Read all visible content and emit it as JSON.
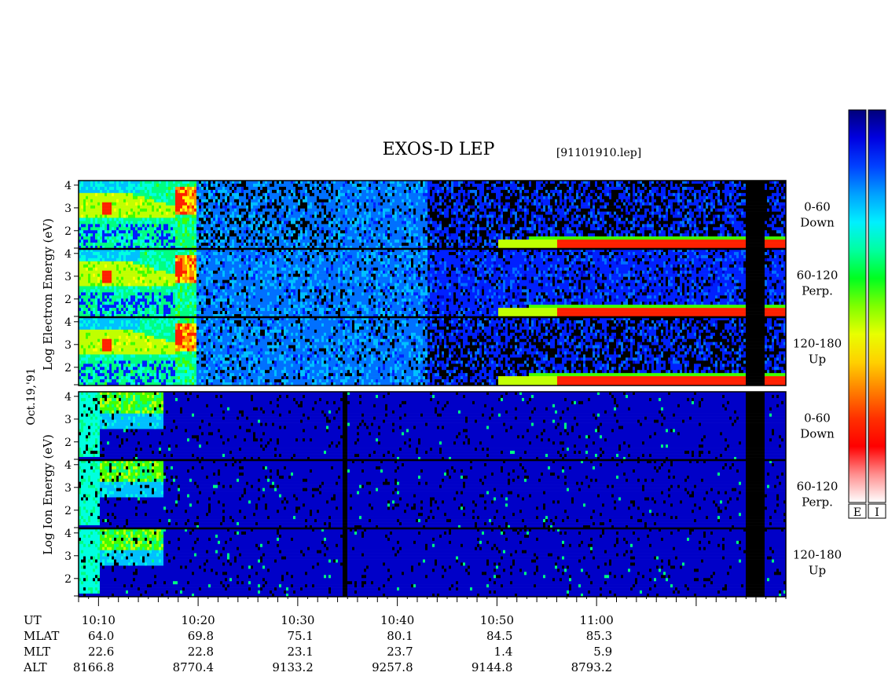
{
  "title": "EXOS-D LEP",
  "file_label": "[91101910.lep]",
  "date_label": "Oct.19,'91",
  "electron_ylabel": "Log  Electron  Energy  (eV)",
  "ion_ylabel": "Log  Ion  Energy  (eV)",
  "row_labels": [
    "UT",
    "MLAT",
    "MLT",
    "ALT"
  ],
  "colorbar": {
    "labels": [
      "E",
      "I"
    ],
    "colors": [
      "#00007a",
      "#0000ff",
      "#0080ff",
      "#00ffff",
      "#00ff80",
      "#00ff00",
      "#80ff00",
      "#ffff00",
      "#ff8000",
      "#ff0000",
      "#ffc0c0",
      "#ffffff"
    ]
  },
  "chart_data": {
    "type": "heatmap",
    "title": "EXOS-D LEP",
    "x_axis": {
      "name": "UT",
      "range": [
        "10:08",
        "11:19"
      ],
      "major_ticks": [
        "10:10",
        "10:20",
        "10:30",
        "10:40",
        "10:50",
        "11:00"
      ]
    },
    "y_axis": {
      "label": "Log Energy (eV)",
      "ticks": [
        2,
        3,
        4
      ],
      "range": [
        1.2,
        4.2
      ]
    },
    "panels": [
      {
        "species": "Electron",
        "pitch_angle": "0-60",
        "direction": "Down"
      },
      {
        "species": "Electron",
        "pitch_angle": "60-120",
        "direction": "Perp."
      },
      {
        "species": "Electron",
        "pitch_angle": "120-180",
        "direction": "Up"
      },
      {
        "species": "Ion",
        "pitch_angle": "0-60",
        "direction": "Down"
      },
      {
        "species": "Ion",
        "pitch_angle": "60-120",
        "direction": "Perp."
      },
      {
        "species": "Ion",
        "pitch_angle": "120-180",
        "direction": "Up"
      }
    ],
    "orbit_table": {
      "UT": [
        "10:10",
        "10:20",
        "10:30",
        "10:40",
        "10:50",
        "11:00"
      ],
      "MLAT": [
        "64.0",
        "69.8",
        "75.1",
        "80.1",
        "84.5",
        "85.3"
      ],
      "MLT": [
        "22.6",
        "22.8",
        "23.1",
        "23.7",
        "1.4",
        "5.9"
      ],
      "ALT": [
        "8166.8",
        "8770.4",
        "9133.2",
        "9257.8",
        "9144.8",
        "8793.2"
      ]
    }
  }
}
